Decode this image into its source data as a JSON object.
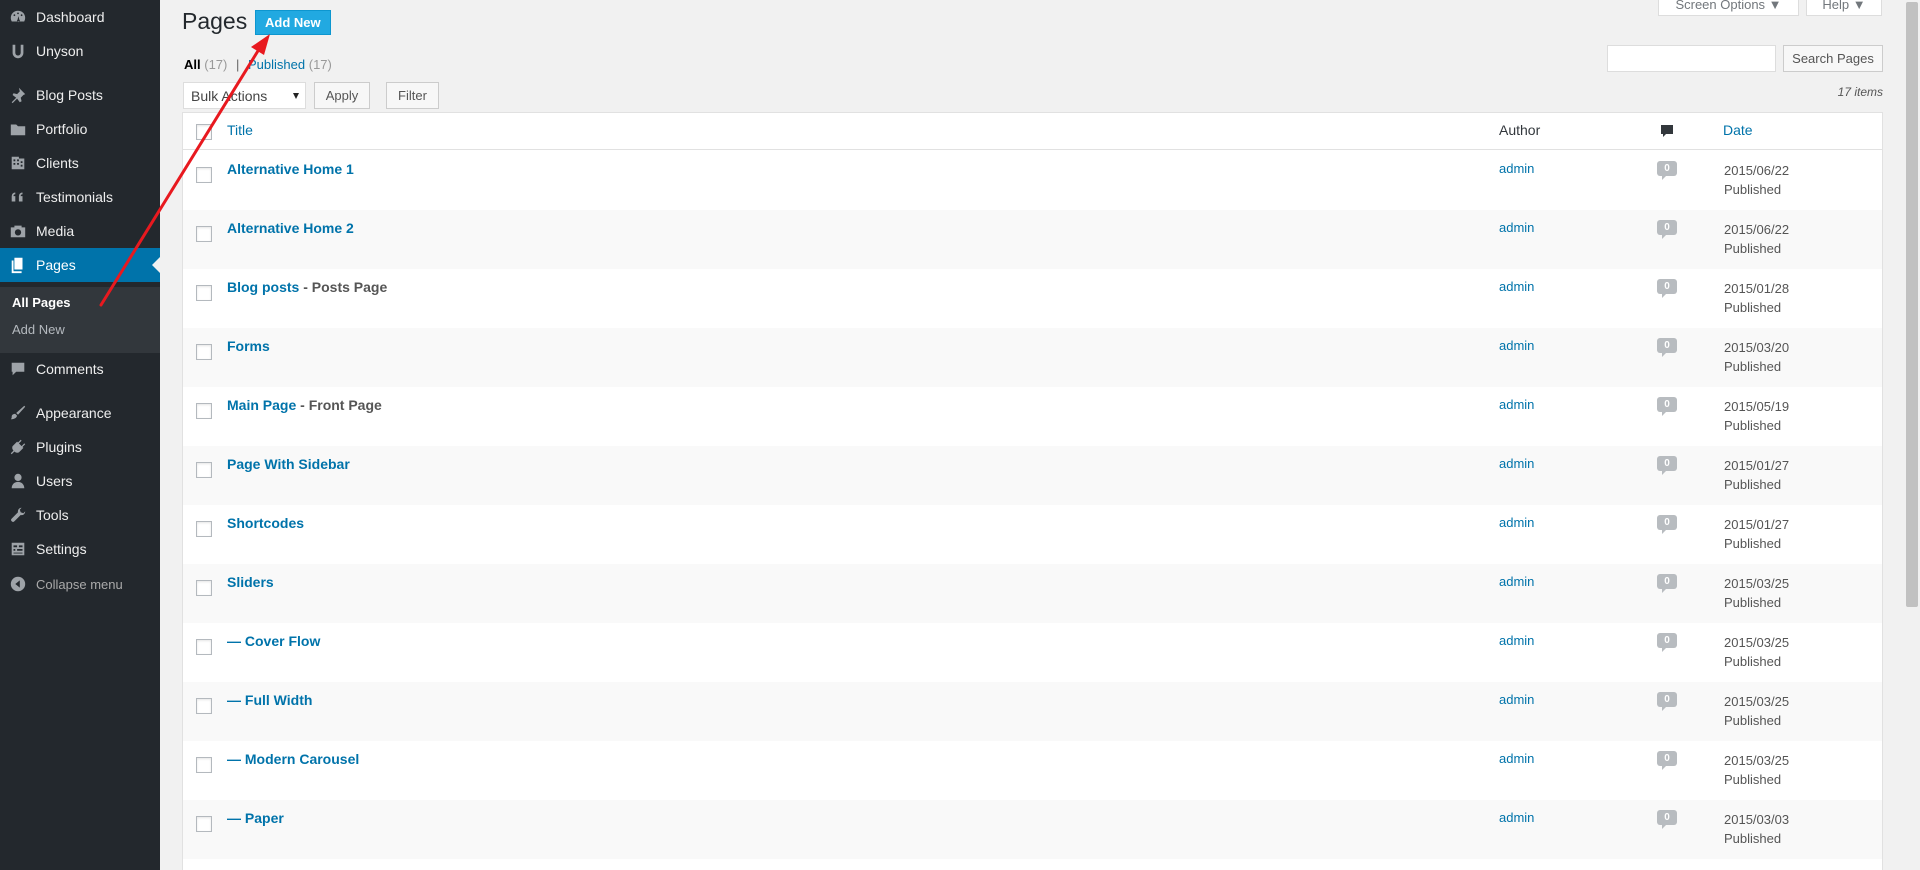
{
  "sidebar": {
    "items": [
      {
        "label": "Dashboard",
        "icon": "dashboard-icon"
      },
      {
        "label": "Unyson",
        "icon": "unyson-icon"
      },
      {
        "label": "Blog Posts",
        "icon": "pin-icon"
      },
      {
        "label": "Portfolio",
        "icon": "portfolio-icon"
      },
      {
        "label": "Clients",
        "icon": "clients-icon"
      },
      {
        "label": "Testimonials",
        "icon": "quote-icon"
      },
      {
        "label": "Media",
        "icon": "media-icon"
      },
      {
        "label": "Pages",
        "icon": "pages-icon"
      },
      {
        "label": "Comments",
        "icon": "comment-icon"
      },
      {
        "label": "Appearance",
        "icon": "brush-icon"
      },
      {
        "label": "Plugins",
        "icon": "plugin-icon"
      },
      {
        "label": "Users",
        "icon": "user-icon"
      },
      {
        "label": "Tools",
        "icon": "wrench-icon"
      },
      {
        "label": "Settings",
        "icon": "settings-icon"
      }
    ],
    "submenu": {
      "all_pages": "All Pages",
      "add_new": "Add New"
    },
    "collapse_label": "Collapse menu"
  },
  "header": {
    "title": "Pages",
    "add_new": "Add New",
    "screen_options": "Screen Options ▼",
    "help": "Help ▼"
  },
  "views": {
    "all_label": "All",
    "all_count": "(17)",
    "separator": "|",
    "published_label": "Published",
    "published_count": "(17)"
  },
  "search": {
    "button": "Search Pages",
    "value": ""
  },
  "tablenav": {
    "bulk_actions": "Bulk Actions",
    "apply": "Apply",
    "filter": "Filter",
    "items_count": "17 items"
  },
  "table": {
    "columns": {
      "title": "Title",
      "author": "Author",
      "comments_icon": "comment-icon",
      "date": "Date"
    },
    "rows": [
      {
        "title": "Alternative Home 1",
        "state": "",
        "author": "admin",
        "comments": "0",
        "date": "2015/06/22",
        "status": "Published"
      },
      {
        "title": "Alternative Home 2",
        "state": "",
        "author": "admin",
        "comments": "0",
        "date": "2015/06/22",
        "status": "Published"
      },
      {
        "title": "Blog posts",
        "state": " - Posts Page",
        "author": "admin",
        "comments": "0",
        "date": "2015/01/28",
        "status": "Published"
      },
      {
        "title": "Forms",
        "state": "",
        "author": "admin",
        "comments": "0",
        "date": "2015/03/20",
        "status": "Published"
      },
      {
        "title": "Main Page",
        "state": " - Front Page",
        "author": "admin",
        "comments": "0",
        "date": "2015/05/19",
        "status": "Published"
      },
      {
        "title": "Page With Sidebar",
        "state": "",
        "author": "admin",
        "comments": "0",
        "date": "2015/01/27",
        "status": "Published"
      },
      {
        "title": "Shortcodes",
        "state": "",
        "author": "admin",
        "comments": "0",
        "date": "2015/01/27",
        "status": "Published"
      },
      {
        "title": "Sliders",
        "state": "",
        "author": "admin",
        "comments": "0",
        "date": "2015/03/25",
        "status": "Published"
      },
      {
        "title": "— Cover Flow",
        "state": "",
        "author": "admin",
        "comments": "0",
        "date": "2015/03/25",
        "status": "Published"
      },
      {
        "title": "— Full Width",
        "state": "",
        "author": "admin",
        "comments": "0",
        "date": "2015/03/25",
        "status": "Published"
      },
      {
        "title": "— Modern Carousel",
        "state": "",
        "author": "admin",
        "comments": "0",
        "date": "2015/03/25",
        "status": "Published"
      },
      {
        "title": "— Paper",
        "state": "",
        "author": "admin",
        "comments": "0",
        "date": "2015/03/03",
        "status": "Published"
      }
    ]
  },
  "colors": {
    "sidebar_bg": "#23282d",
    "active_bg": "#0073aa",
    "link": "#0073aa",
    "add_new_button": "#21a9e1",
    "annotation_arrow": "#e8191f"
  }
}
